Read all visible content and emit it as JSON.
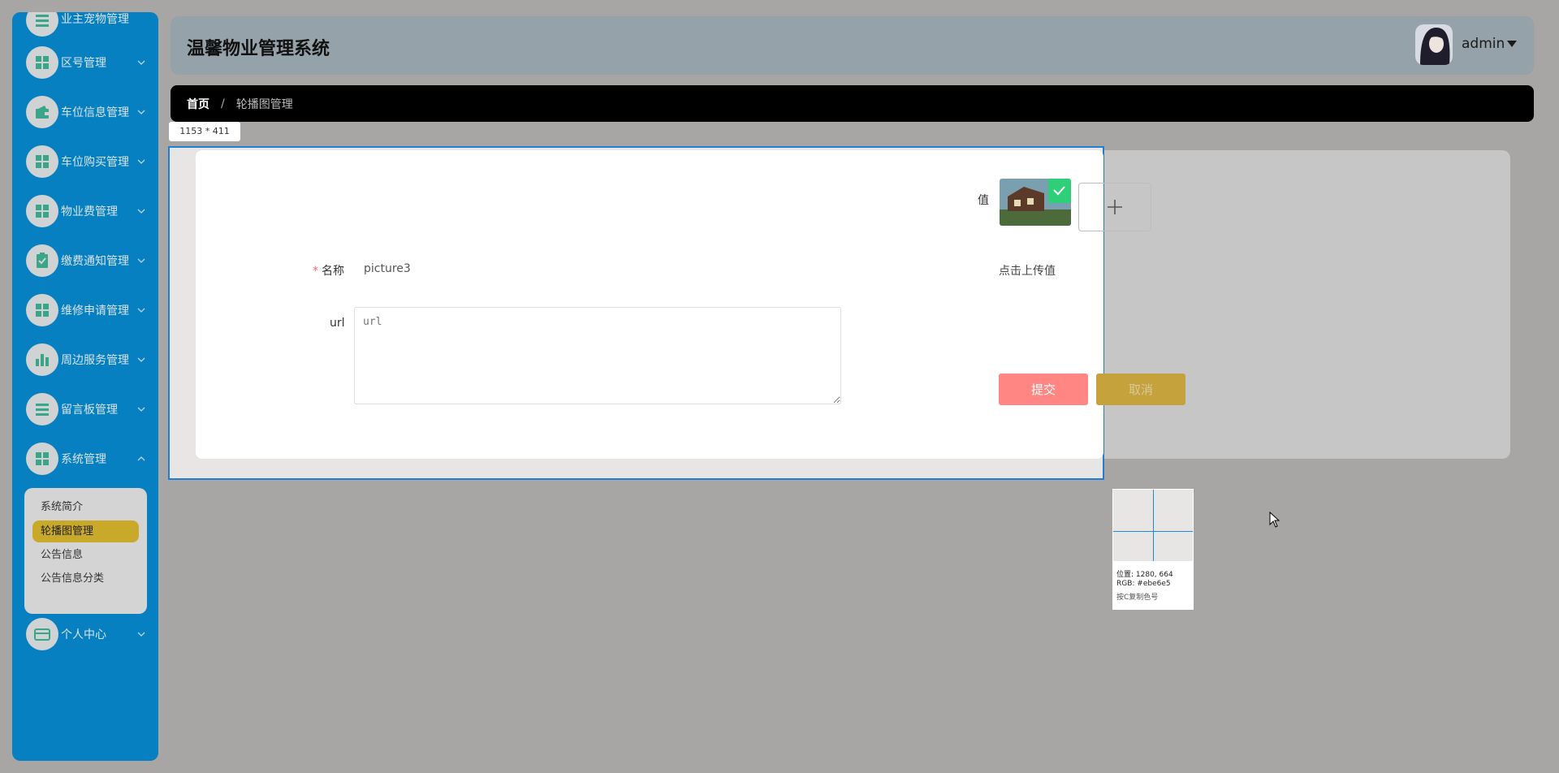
{
  "app": {
    "title": "温馨物业管理系统"
  },
  "user": {
    "name": "admin"
  },
  "sidebar": {
    "partial_top_label": "业主宠物管理",
    "items": [
      {
        "label": "区号管理",
        "icon": "grid-icon"
      },
      {
        "label": "车位信息管理",
        "icon": "wallet-icon"
      },
      {
        "label": "车位购买管理",
        "icon": "grid-icon"
      },
      {
        "label": "物业费管理",
        "icon": "grid-icon"
      },
      {
        "label": "缴费通知管理",
        "icon": "clipboard-check-icon"
      },
      {
        "label": "维修申请管理",
        "icon": "grid-icon"
      },
      {
        "label": "周边服务管理",
        "icon": "bar-chart-icon"
      },
      {
        "label": "留言板管理",
        "icon": "list-icon"
      },
      {
        "label": "系统管理",
        "icon": "grid-icon"
      },
      {
        "label": "个人中心",
        "icon": "card-icon"
      }
    ],
    "submenu": [
      {
        "label": "系统简介"
      },
      {
        "label": "轮播图管理"
      },
      {
        "label": "公告信息"
      },
      {
        "label": "公告信息分类"
      }
    ]
  },
  "breadcrumb": {
    "home": "首页",
    "separator": "/",
    "current": "轮播图管理"
  },
  "selection": {
    "size_label": "1153 * 411"
  },
  "form": {
    "value_label": "值",
    "name_label": "名称",
    "name_required_mark": "*",
    "name_value": "picture3",
    "url_label": "url",
    "url_placeholder": "url",
    "upload_hint": "点击上传值",
    "submit_label": "提交",
    "cancel_label": "取消"
  },
  "picker": {
    "position_text": "位置: 1280, 664",
    "rgb_text": "RGB: #ebe6e5",
    "hint_text": "按C复制色号"
  },
  "colors": {
    "sidebar_bg": "#0780c2",
    "submit_bg": "#ff8682",
    "cancel_bg": "#c6a23c",
    "active_submenu_bg": "#c9a92a",
    "selection_border": "#1d7fd8"
  }
}
